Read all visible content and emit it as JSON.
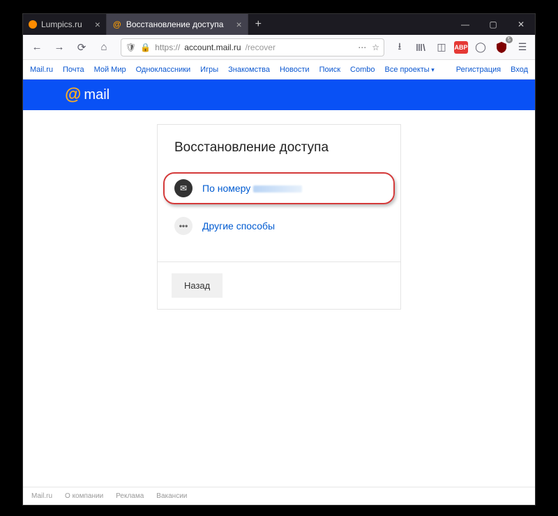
{
  "tabs": {
    "t0": "Lumpics.ru",
    "t1": "Восстановление доступа"
  },
  "url": {
    "scheme": "https://",
    "host": "account.mail.ru",
    "path": "/recover"
  },
  "ublock_count": "5",
  "nav": {
    "l0": "Mail.ru",
    "l1": "Почта",
    "l2": "Мой Мир",
    "l3": "Одноклассники",
    "l4": "Игры",
    "l5": "Знакомства",
    "l6": "Новости",
    "l7": "Поиск",
    "l8": "Combo",
    "l9": "Все проекты",
    "r0": "Регистрация",
    "r1": "Вход"
  },
  "logo": "mail",
  "card": {
    "title": "Восстановление доступа",
    "opt1": "По номеру",
    "opt2": "Другие способы",
    "back": "Назад"
  },
  "footer": {
    "f0": "Mail.ru",
    "f1": "О компании",
    "f2": "Реклама",
    "f3": "Вакансии"
  }
}
